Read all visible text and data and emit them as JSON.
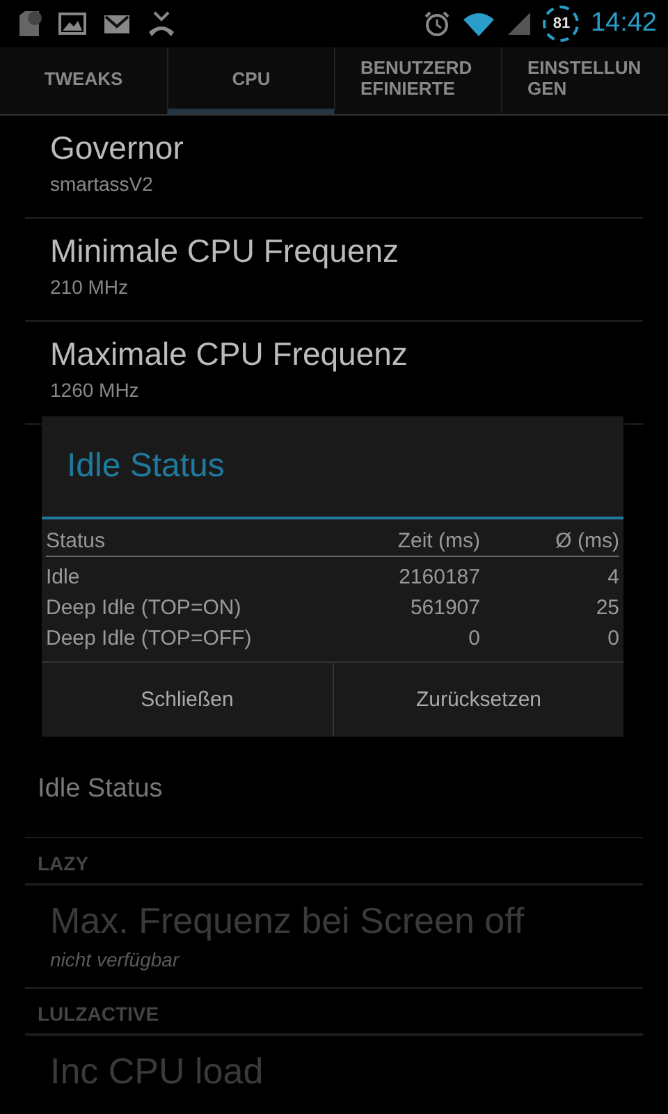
{
  "status_bar": {
    "battery": "81",
    "time": "14:42"
  },
  "tabs": [
    {
      "label": "TWEAKS",
      "selected": false
    },
    {
      "label": "CPU",
      "selected": true
    },
    {
      "label": "BENUTZERD EFINIERTE",
      "selected": false
    },
    {
      "label": "EINSTELLUN GEN",
      "selected": false
    }
  ],
  "list": [
    {
      "kind": "item",
      "title": "Governor",
      "summary": "smartassV2",
      "disabled": false
    },
    {
      "kind": "item",
      "title": "Minimale CPU Frequenz",
      "summary": "210 MHz",
      "disabled": false
    },
    {
      "kind": "item",
      "title": "Maximale CPU Frequenz",
      "summary": "1260 MHz",
      "disabled": false
    },
    {
      "kind": "hidden"
    },
    {
      "kind": "plain",
      "title": "Idle Status"
    },
    {
      "kind": "header",
      "title": "LAZY"
    },
    {
      "kind": "item",
      "title": "Max. Frequenz bei Screen off",
      "summary": "nicht verfügbar",
      "disabled": true
    },
    {
      "kind": "header",
      "title": "LULZACTIVE"
    },
    {
      "kind": "item",
      "title": "Inc CPU load",
      "disabled": true
    }
  ],
  "dialog": {
    "title": "Idle Status",
    "columns": [
      "Status",
      "Zeit (ms)",
      "Ø (ms)"
    ],
    "rows": [
      [
        "Idle",
        "2160187",
        "4"
      ],
      [
        "Deep Idle (TOP=ON)",
        "561907",
        "25"
      ],
      [
        "Deep Idle (TOP=OFF)",
        "0",
        "0"
      ]
    ],
    "buttons": [
      "Schließen",
      "Zurücksetzen"
    ]
  }
}
